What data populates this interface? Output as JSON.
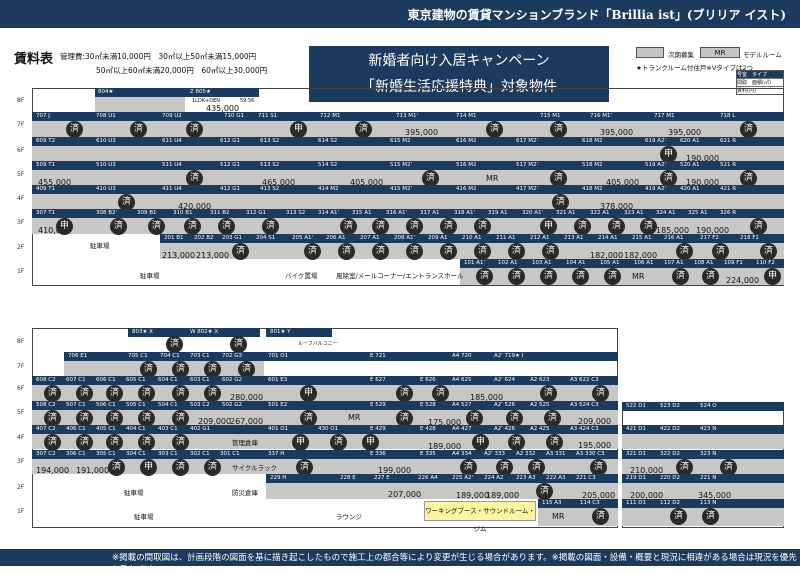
{
  "header": {
    "brand_line": "東京建物の賃貸マンションブランド「Brillia ist」(ブリリア イスト)"
  },
  "title": "賃料表",
  "fees": {
    "line1": "管理費:30㎡未満10,000円　30㎡以上50㎡未満15,000円",
    "line2": "50㎡以上60㎡未満20,000円　60㎡以上30,000円"
  },
  "campaign": {
    "line1": "新婚者向け入居キャンペーン",
    "line2": "「新婚生活応援特典」対象物件"
  },
  "legend": {
    "next_label": "次期募集",
    "model_box": "MR",
    "model_label": "モデルルーム",
    "note": "★トランクルーム付住戸※Vタイプは2つ",
    "table_head": "号室　タイプ",
    "row1": "間取　面積(㎡)",
    "row2": "賃料(円)"
  },
  "stamps": {
    "contracted": "済",
    "applied": "申"
  },
  "floors": [
    "8F",
    "7F",
    "6F",
    "5F",
    "4F",
    "3F",
    "2F",
    "1F"
  ],
  "top_building": {
    "units_8f": [
      {
        "id": "804★",
        "type": ""
      },
      {
        "id": "Z 805★",
        "type": "V",
        "layout": "1LDK+DEN",
        "area": "59.56",
        "price": "435,000"
      }
    ],
    "units_7f": [
      "707 J",
      "708 U1",
      "709 U2",
      "710 G1",
      "711 S1",
      "712 M1",
      "713 M1'",
      "714 M1",
      "715 M1",
      "716 M1'",
      "717 M1",
      "718 L"
    ],
    "prices_7f": [
      "395,000",
      "395,000",
      "395,000"
    ],
    "units_6f": [
      "609 T2",
      "610 U3",
      "611 U4",
      "612 G1",
      "613 S2",
      "614 S2",
      "615 M2",
      "616 M2",
      "617 M2'",
      "618 M2",
      "619 A2'",
      "620 A1",
      "621 R"
    ],
    "prices_6f": [
      "190,000"
    ],
    "units_5f": [
      "509 T1",
      "510 U3",
      "511 U4",
      "512 G1",
      "513 S2",
      "514 S2",
      "515 M2'",
      "516 M2",
      "517 M2'",
      "518 M2",
      "519 A2'",
      "520 A1",
      "521 R"
    ],
    "prices_5f": [
      "455,000",
      "465,000",
      "405,000",
      "MR",
      "405,000",
      "190,000"
    ],
    "units_4f": [
      "409 T1",
      "410 U3",
      "411 U4",
      "412 G1",
      "413 S2",
      "414 M2",
      "415 M2'",
      "416 M2",
      "417 M2'",
      "418 M2",
      "419 A2'",
      "420 A1",
      "421 R"
    ],
    "prices_4f": [
      "420,000",
      "378,000"
    ],
    "units_3f": [
      "307 T1",
      "308 B2'",
      "309 B1",
      "310 B1",
      "311 B2",
      "312 G1",
      "313 S2",
      "314 A1'",
      "315 A1",
      "316 A1'",
      "317 A1",
      "318 A1'",
      "319 A1",
      "320 A1'",
      "321 A1",
      "322 A1",
      "323 A1",
      "324 A1",
      "325 A1",
      "326 R"
    ],
    "prices_3f": [
      "410,000",
      "185,000",
      "190,000"
    ],
    "units_2f": [
      "201 B1",
      "202 B2",
      "203 G1",
      "204 S1",
      "205 A1'",
      "206 A1",
      "207 A1",
      "208 A1'",
      "209 A1",
      "210 A1",
      "211 A1",
      "212 A1",
      "213 A1",
      "214 A1",
      "215 A1",
      "216 A1",
      "217 F2",
      "218 F1"
    ],
    "prices_2f": [
      "213,000",
      "213,000",
      "182,000",
      "182,000"
    ],
    "units_1f": [
      "101 A1'",
      "102 A1",
      "103 A1",
      "104 A1",
      "105 A1",
      "106 A1",
      "107 A1",
      "108 A1",
      "109 F1",
      "110 F2"
    ],
    "prices_1f": [
      "MR",
      "224,000"
    ],
    "ground": {
      "parking": "駐車場",
      "bike": "バイク置場",
      "lobby": "風除室/メールコーナー/エントランスホール"
    }
  },
  "bottom_building": {
    "units_8f": [
      "803★ X",
      "W 802★ X",
      "801★ Y"
    ],
    "roof_balcony": "ルーフバルコニー",
    "units_7f": [
      "706 E1",
      "705 C1",
      "704 C1",
      "703 C1",
      "702 G3",
      "701 O1",
      "E 721",
      "A4 720",
      "A2' 719★ I"
    ],
    "units_6f": [
      "608 C2",
      "607 C1",
      "606 C1",
      "605 C1",
      "604 C1",
      "603 C1",
      "602 G2",
      "601 E3",
      "E 627",
      "E 626",
      "A4 625",
      "A2' 624",
      "A2 623",
      "A3 622 C3"
    ],
    "prices_6f": [
      "280,000",
      "185,000"
    ],
    "units_5f": [
      "508 C2",
      "507 C1",
      "506 C1",
      "505 C1",
      "504 C1",
      "503 C2",
      "502 G2",
      "501 E2",
      "E 529",
      "E 528",
      "A4 527",
      "A2' 526",
      "A2 525",
      "A3 524 C3"
    ],
    "prices_5f": [
      "267,000",
      "209,000",
      "MR",
      "175,000",
      "209,000"
    ],
    "units_4f": [
      "407 C2",
      "406 C1",
      "405 C1",
      "404 C1",
      "403 C1",
      "402 G1",
      "401 O1",
      "430 O1",
      "E 429",
      "E 428",
      "A4 427",
      "A2' 426",
      "A2 425",
      "A3 424 C3"
    ],
    "prices_4f": [
      "189,000",
      "195,000"
    ],
    "units_3f": [
      "307 C2",
      "306 C1",
      "305 C1",
      "304 C1",
      "303 C1",
      "302 C1",
      "301 C1",
      "337 H",
      "E 336",
      "E 335",
      "A4 334",
      "A2' 333",
      "A2 332",
      "A3 331",
      "A3 330 C3"
    ],
    "prices_3f": [
      "194,000",
      "191,000",
      "199,000"
    ],
    "units_2f": [
      "229 H",
      "228 E",
      "227 E",
      "226 A4",
      "225 A2'",
      "224 A2",
      "223 A3",
      "222 A3",
      "221 C3"
    ],
    "prices_2f": [
      "207,000",
      "189,000",
      "189,000",
      "205,000"
    ],
    "units_1f": [
      "115 A3",
      "114 C3"
    ],
    "prices_1f": [
      "MR"
    ],
    "ground": {
      "parking": "駐車場",
      "lounge": "ラウンジ",
      "work": "ワーキングブース・サウンドルーム・ジム",
      "manage": "管理倉庫",
      "cycle": "サイクルラック",
      "security": "防災倉庫"
    },
    "annex": {
      "units": [
        "522 D1",
        "523 D2",
        "524 O",
        "421 D1",
        "422 D2",
        "423 N",
        "321 D1",
        "322 D2",
        "323 N",
        "219 D1",
        "220 D2",
        "221 N",
        "111 D1",
        "112 D2",
        "113 N"
      ],
      "prices": [
        "210,000",
        "200,000",
        "345,000"
      ]
    }
  },
  "footer": "※掲載の間取図は、計画段階の図面を基に描き起こしたもので施工上の都合等により変更が生じる場合があります。※掲載の図面・設備・概要と現況に相違がある場合は現況を優先と致します。"
}
